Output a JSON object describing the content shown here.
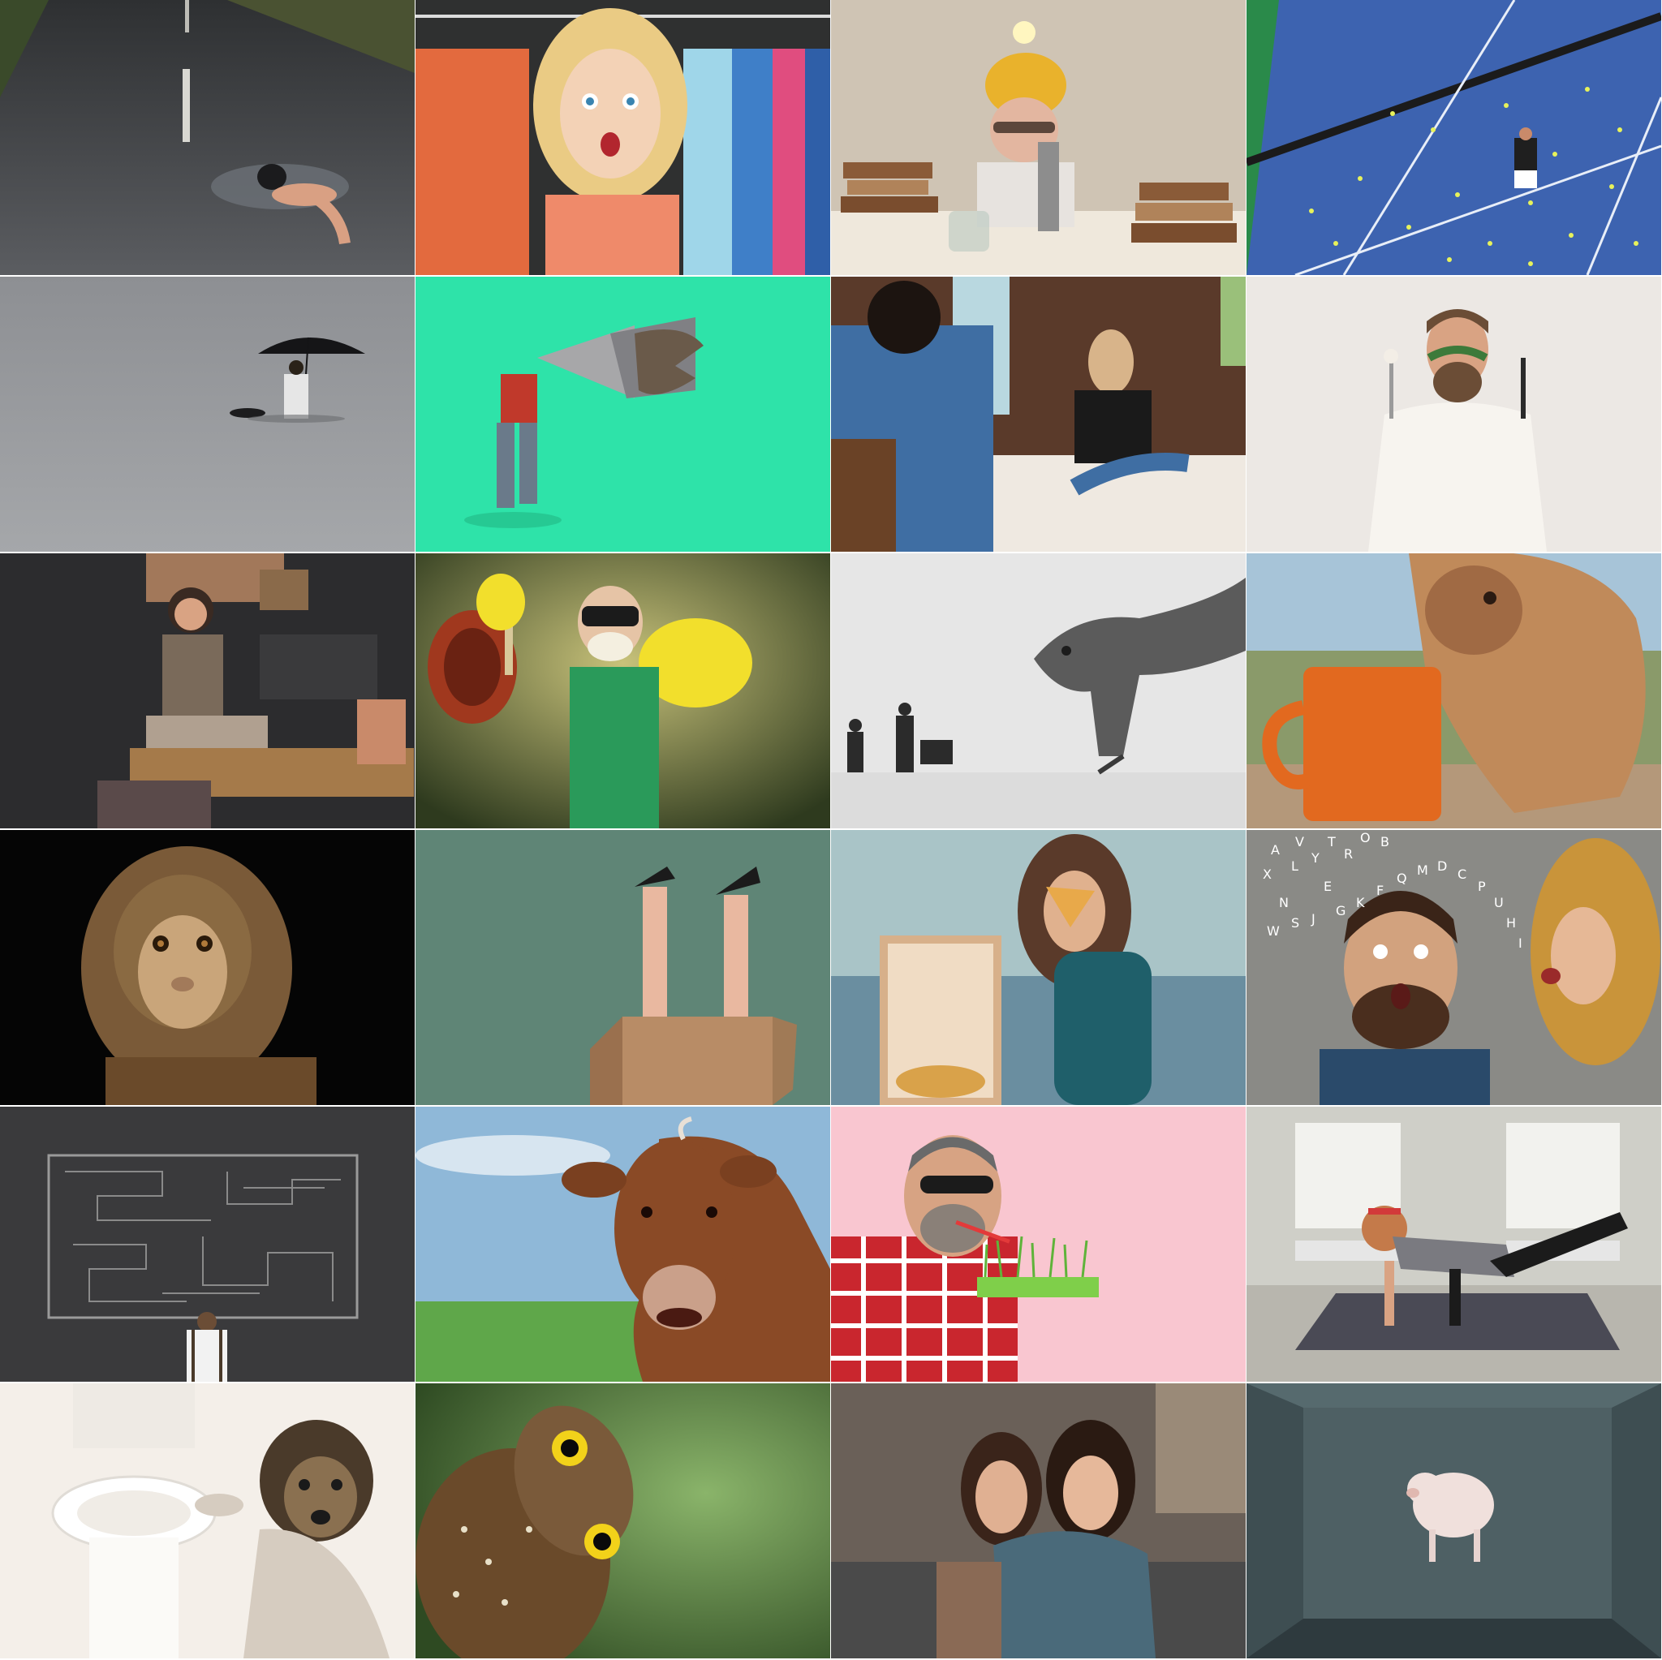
{
  "mosaic": {
    "columns": 4,
    "rows": 6,
    "tiles": [
      {
        "subject": "swimmer-on-road",
        "palette": [
          "#4a4c50",
          "#2b2c30",
          "#c9c8c2"
        ]
      },
      {
        "subject": "surprised-woman-clothes-rack",
        "palette": [
          "#d35a3a",
          "#3f8fc8",
          "#f3d2b6"
        ]
      },
      {
        "subject": "lightbulb-helmet-microscope",
        "palette": [
          "#cfc4b4",
          "#e9b22c",
          "#6b4d36"
        ]
      },
      {
        "subject": "tennis-court-balls",
        "palette": [
          "#3d63b0",
          "#2a8a4a",
          "#e7f25b"
        ]
      },
      {
        "subject": "umbrella-man-in-flood",
        "palette": [
          "#8d8f93",
          "#1c1c1e",
          "#e6e6e6"
        ]
      },
      {
        "subject": "dinosaur-megaphone",
        "palette": [
          "#2ee3a9",
          "#a7a7a9",
          "#b84a3a"
        ]
      },
      {
        "subject": "couple-restaurant-argument",
        "palette": [
          "#4a3022",
          "#3f6ea3",
          "#efe9e1"
        ]
      },
      {
        "subject": "chef-herb-mustache",
        "palette": [
          "#ece8e4",
          "#f7f4ef",
          "#6b4d36"
        ]
      },
      {
        "subject": "cluttered-office-desk",
        "palette": [
          "#2c2c2e",
          "#a57a4a",
          "#7a6a5a"
        ]
      },
      {
        "subject": "plunger-rubber-gloves",
        "palette": [
          "#3e4a2c",
          "#f2df2c",
          "#2a9a5a"
        ]
      },
      {
        "subject": "lizard-toy-soldiers",
        "palette": [
          "#e6e6e6",
          "#5b5b5b",
          "#2b2b2b"
        ]
      },
      {
        "subject": "camel-orange-mug",
        "palette": [
          "#8a9a6a",
          "#e2691f",
          "#c08a5a"
        ]
      },
      {
        "subject": "monkey-portrait",
        "palette": [
          "#050505",
          "#8a6a42",
          "#c9a57a"
        ]
      },
      {
        "subject": "legs-in-box",
        "palette": [
          "#5f8576",
          "#b88c66",
          "#e9b8a0"
        ]
      },
      {
        "subject": "woman-pizza-sofa",
        "palette": [
          "#a9c4c7",
          "#1f5f6a",
          "#d4a276"
        ]
      },
      {
        "subject": "woman-shouting-letters",
        "palette": [
          "#8a8a86",
          "#1e2a3a",
          "#ffffff"
        ]
      },
      {
        "subject": "maze-chalkboard",
        "palette": [
          "#3a3a3c",
          "#9a9a9a",
          "#ffffff"
        ]
      },
      {
        "subject": "cow-in-field",
        "palette": [
          "#8fb8d8",
          "#5fa74a",
          "#8a4a26"
        ]
      },
      {
        "subject": "man-grass-straw",
        "palette": [
          "#f9c6d0",
          "#c9262e",
          "#7fcf4a"
        ]
      },
      {
        "subject": "yoga-man-mat",
        "palette": [
          "#cfcfc8",
          "#4a4a55",
          "#c47a4a"
        ]
      },
      {
        "subject": "dog-toilet",
        "palette": [
          "#f4efe9",
          "#ffffff",
          "#4a3a2a"
        ]
      },
      {
        "subject": "owl-tilted-head",
        "palette": [
          "#4a7a3a",
          "#6a4a2a",
          "#f2d21a"
        ]
      },
      {
        "subject": "scared-women-pillow",
        "palette": [
          "#4a4a4a",
          "#4a6a7a",
          "#8a6a55"
        ]
      },
      {
        "subject": "floating-pig-room",
        "palette": [
          "#4e6064",
          "#2e3a3e",
          "#f0e0dc"
        ]
      }
    ]
  },
  "tile_16_text": {
    "letter_stream": [
      "X",
      "N",
      "L",
      "Y",
      "E",
      "R",
      "A",
      "V",
      "T",
      "O",
      "B",
      "W",
      "S",
      "J",
      "G",
      "K",
      "F",
      "Q",
      "M",
      "D",
      "C",
      "P",
      "U",
      "H",
      "I"
    ]
  }
}
